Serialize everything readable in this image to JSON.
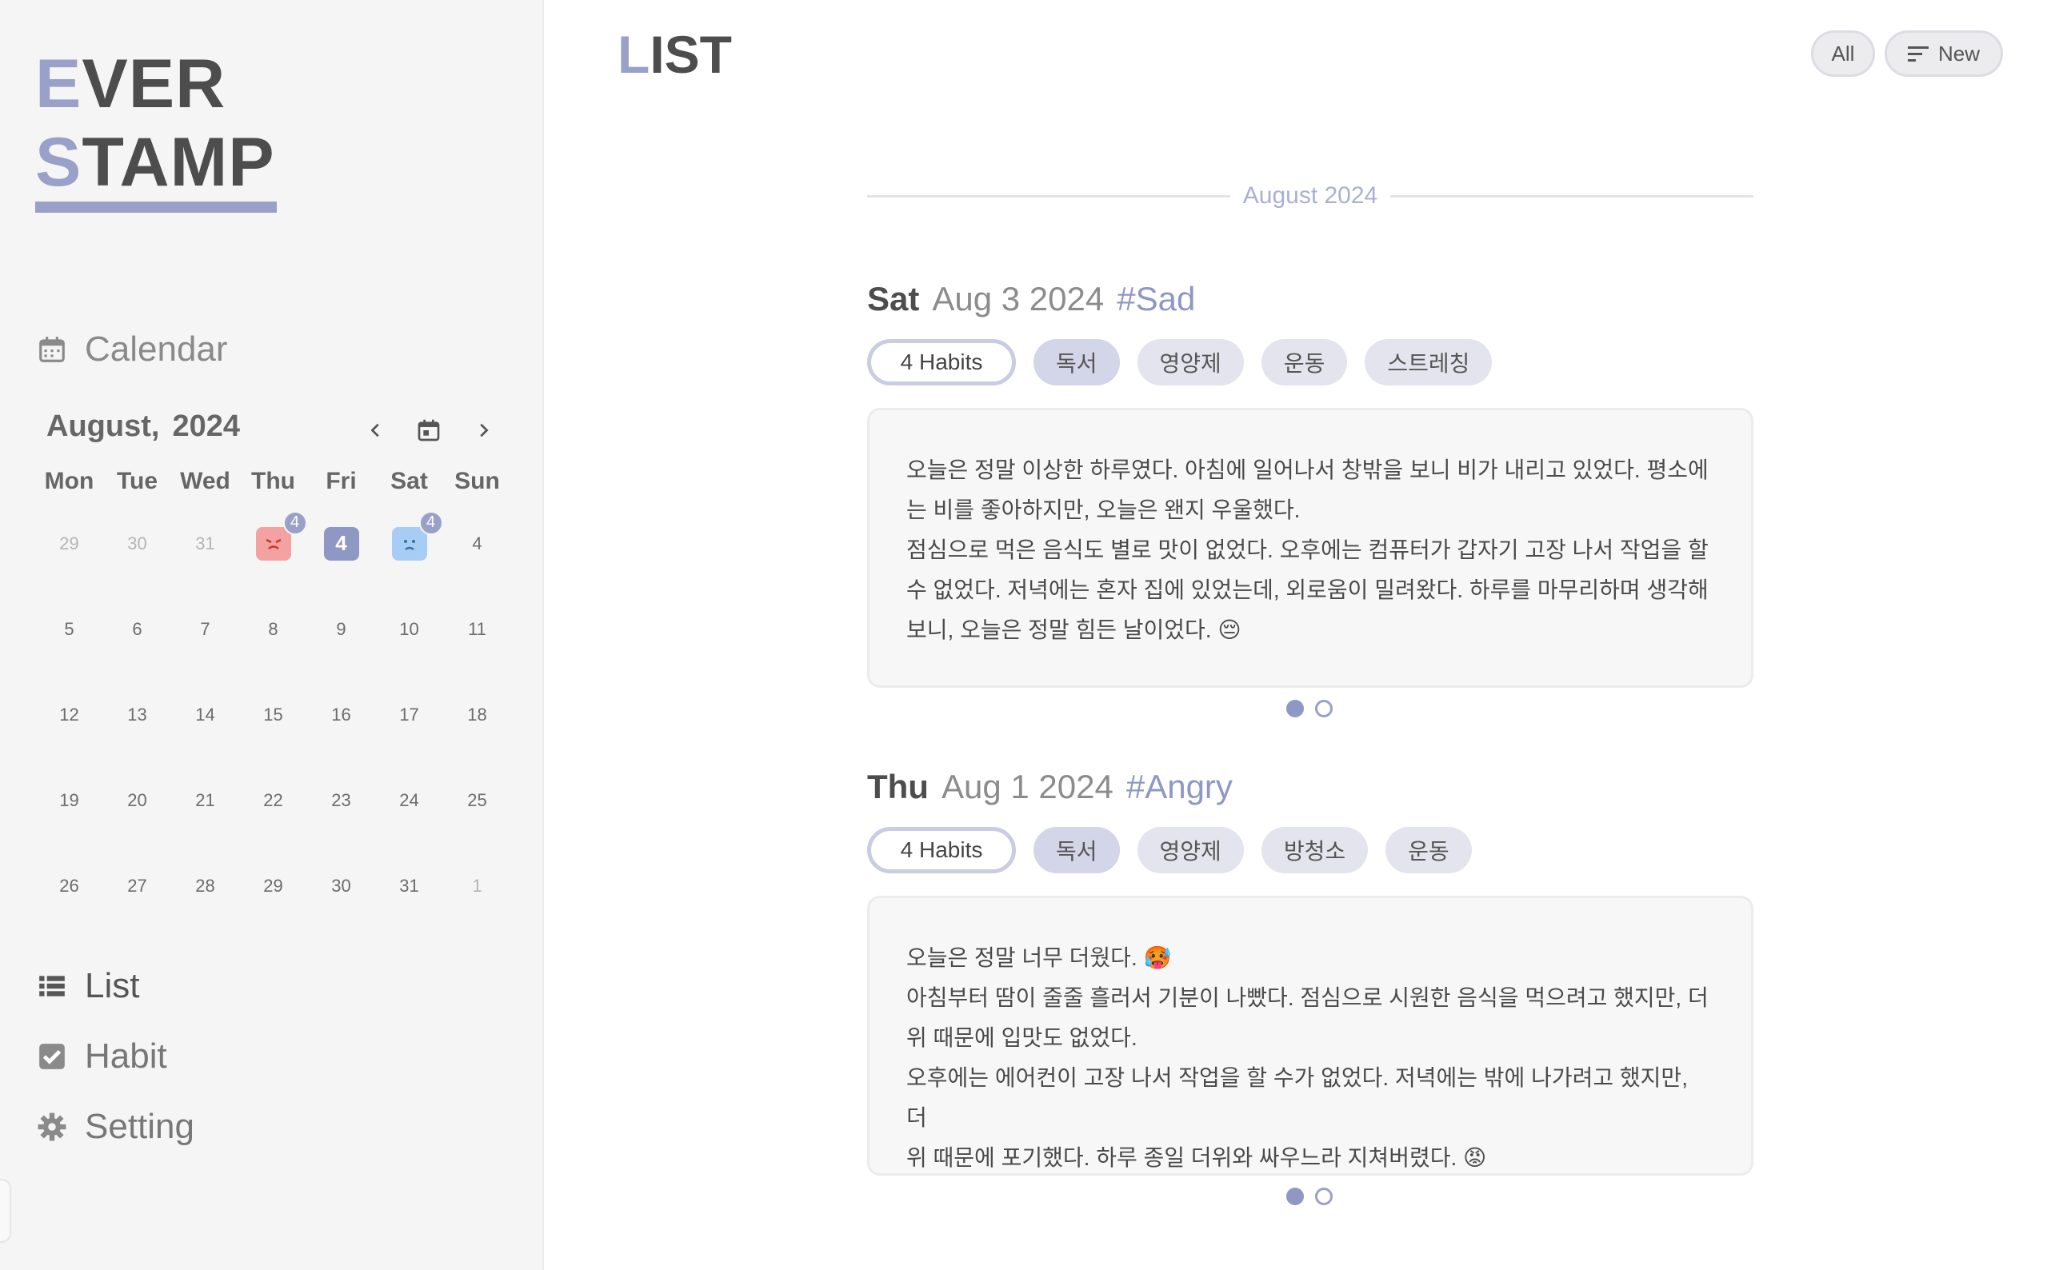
{
  "app": {
    "logo_line1_first": "E",
    "logo_line1_rest": "VER",
    "logo_line2_first": "S",
    "logo_line2_rest": "TAMP",
    "accent_color": "#9aa1c9"
  },
  "sidebar": {
    "calendar_label": "Calendar",
    "list_label": "List",
    "habit_label": "Habit",
    "setting_label": "Setting"
  },
  "calendar": {
    "month": "August,",
    "year": "2024",
    "weekdays": [
      "Mon",
      "Tue",
      "Wed",
      "Thu",
      "Fri",
      "Sat",
      "Sun"
    ],
    "rows": [
      [
        "29",
        "30",
        "31",
        "",
        "4",
        "",
        "4"
      ],
      [
        "5",
        "6",
        "7",
        "8",
        "9",
        "10",
        "11"
      ],
      [
        "12",
        "13",
        "14",
        "15",
        "16",
        "17",
        "18"
      ],
      [
        "19",
        "20",
        "21",
        "22",
        "23",
        "24",
        "25"
      ],
      [
        "26",
        "27",
        "28",
        "29",
        "30",
        "31",
        "1"
      ]
    ],
    "thu_badge": "4",
    "sat_badge": "4"
  },
  "header": {
    "title_first": "L",
    "title_rest": "IST",
    "filter_all": "All",
    "filter_new": "New"
  },
  "month_divider": "August 2024",
  "entries": [
    {
      "day": "Sat",
      "date": "Aug 3 2024",
      "emotion": "#Sad",
      "habits_count": "4 Habits",
      "tags": [
        "독서",
        "영양제",
        "운동",
        "스트레칭"
      ],
      "text": "오늘은 정말 이상한 하루였다. 아침에 일어나서 창밖을 보니 비가 내리고 있었다. 평소에\n는 비를 좋아하지만, 오늘은 왠지 우울했다.\n점심으로 먹은 음식도 별로 맛이 없었다. 오후에는 컴퓨터가 갑자기 고장 나서 작업을 할\n수 없었다. 저녁에는 혼자 집에 있었는데, 외로움이 밀려왔다. 하루를 마무리하며 생각해\n보니, 오늘은 정말 힘든 날이었다. 😔"
    },
    {
      "day": "Thu",
      "date": "Aug 1 2024",
      "emotion": "#Angry",
      "habits_count": "4 Habits",
      "tags": [
        "독서",
        "영양제",
        "방청소",
        "운동"
      ],
      "text": "오늘은 정말 너무 더웠다. 🥵\n아침부터 땀이 줄줄 흘러서 기분이 나빴다. 점심으로 시원한 음식을 먹으려고 했지만, 더\n위 때문에 입맛도 없었다.\n오후에는 에어컨이 고장 나서 작업을 할 수가 없었다. 저녁에는 밖에 나가려고 했지만, 더\n위 때문에 포기했다. 하루 종일 더위와 싸우느라 지쳐버렸다. 😡"
    }
  ]
}
